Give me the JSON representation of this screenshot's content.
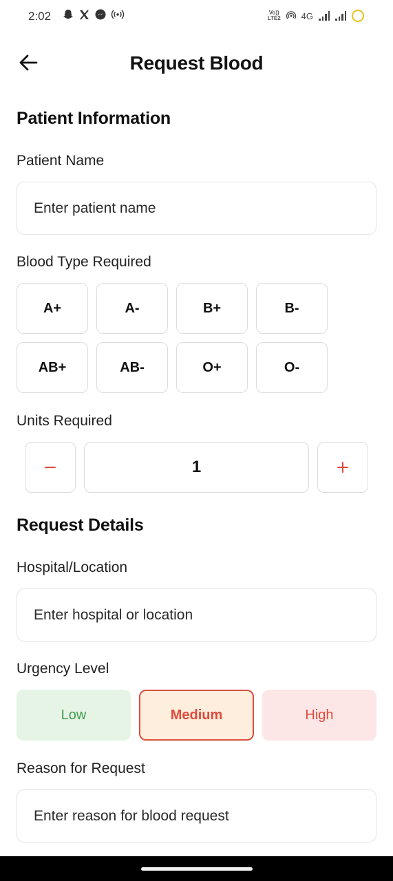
{
  "status_bar": {
    "time": "2:02",
    "left_icons": [
      "snapchat-icon",
      "x-icon",
      "messenger-icon",
      "hotspot-icon"
    ],
    "network": "4G",
    "volte": "VoLTE2"
  },
  "app_bar": {
    "title": "Request Blood",
    "back_icon": "arrow-left-icon"
  },
  "patient_section": {
    "title": "Patient Information",
    "name_label": "Patient Name",
    "name_placeholder": "Enter patient name",
    "blood_type_label": "Blood Type Required",
    "blood_types": [
      "A+",
      "A-",
      "B+",
      "B-",
      "AB+",
      "AB-",
      "O+",
      "O-"
    ],
    "units_label": "Units Required",
    "units_value": "1",
    "minus_label": "−",
    "plus_label": "+"
  },
  "request_section": {
    "title": "Request Details",
    "location_label": "Hospital/Location",
    "location_placeholder": "Enter hospital or location",
    "urgency_label": "Urgency Level",
    "urgency_options": [
      "Low",
      "Medium",
      "High"
    ],
    "urgency_selected": "Medium",
    "reason_label": "Reason for Request",
    "reason_placeholder": "Enter reason for blood request"
  },
  "colors": {
    "accent": "#e04a3a",
    "low_bg": "#e6f4e6",
    "low_text": "#3f9f4a",
    "medium_bg": "#fdeedd",
    "high_bg": "#fde6e6"
  }
}
